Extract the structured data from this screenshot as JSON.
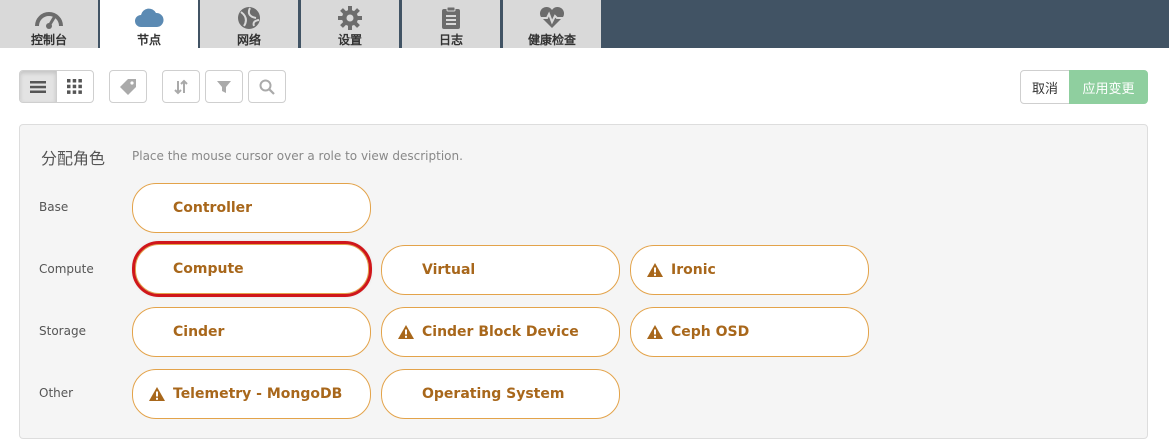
{
  "nav": {
    "tabs": [
      {
        "label": "控制台",
        "icon": "dashboard-gauge-icon"
      },
      {
        "label": "节点",
        "icon": "cloud-icon"
      },
      {
        "label": "网络",
        "icon": "globe-network-icon"
      },
      {
        "label": "设置",
        "icon": "gear-icon"
      },
      {
        "label": "日志",
        "icon": "clipboard-log-icon"
      },
      {
        "label": "健康检查",
        "icon": "heart-pulse-icon"
      }
    ],
    "active_tab": "节点"
  },
  "toolbar": {
    "view_modes": [
      "list-view",
      "grid-view"
    ],
    "active_view": "list-view",
    "tools": [
      "tag-icon",
      "sort-icon",
      "filter-icon",
      "search-icon"
    ],
    "cancel_label": "取消",
    "apply_label": "应用变更"
  },
  "panel": {
    "title": "分配角色",
    "hint": "Place the mouse cursor over a role to view description.",
    "groups": [
      {
        "label": "Base",
        "roles": [
          {
            "name": "Controller",
            "warning": false
          }
        ]
      },
      {
        "label": "Compute",
        "roles": [
          {
            "name": "Compute",
            "warning": false,
            "highlighted": true
          },
          {
            "name": "Virtual",
            "warning": false
          },
          {
            "name": "Ironic",
            "warning": true
          }
        ]
      },
      {
        "label": "Storage",
        "roles": [
          {
            "name": "Cinder",
            "warning": false
          },
          {
            "name": "Cinder Block Device",
            "warning": true
          },
          {
            "name": "Ceph OSD",
            "warning": true
          }
        ]
      },
      {
        "label": "Other",
        "roles": [
          {
            "name": "Telemetry - MongoDB",
            "warning": true
          },
          {
            "name": "Operating System",
            "warning": false
          }
        ]
      }
    ]
  },
  "colors": {
    "topbar": "#415364",
    "tab_inactive": "#d9d9d9",
    "role_border": "#e3a34a",
    "role_text": "#a8671b",
    "apply_button": "#8fcf9f",
    "highlight": "#d0161a"
  }
}
